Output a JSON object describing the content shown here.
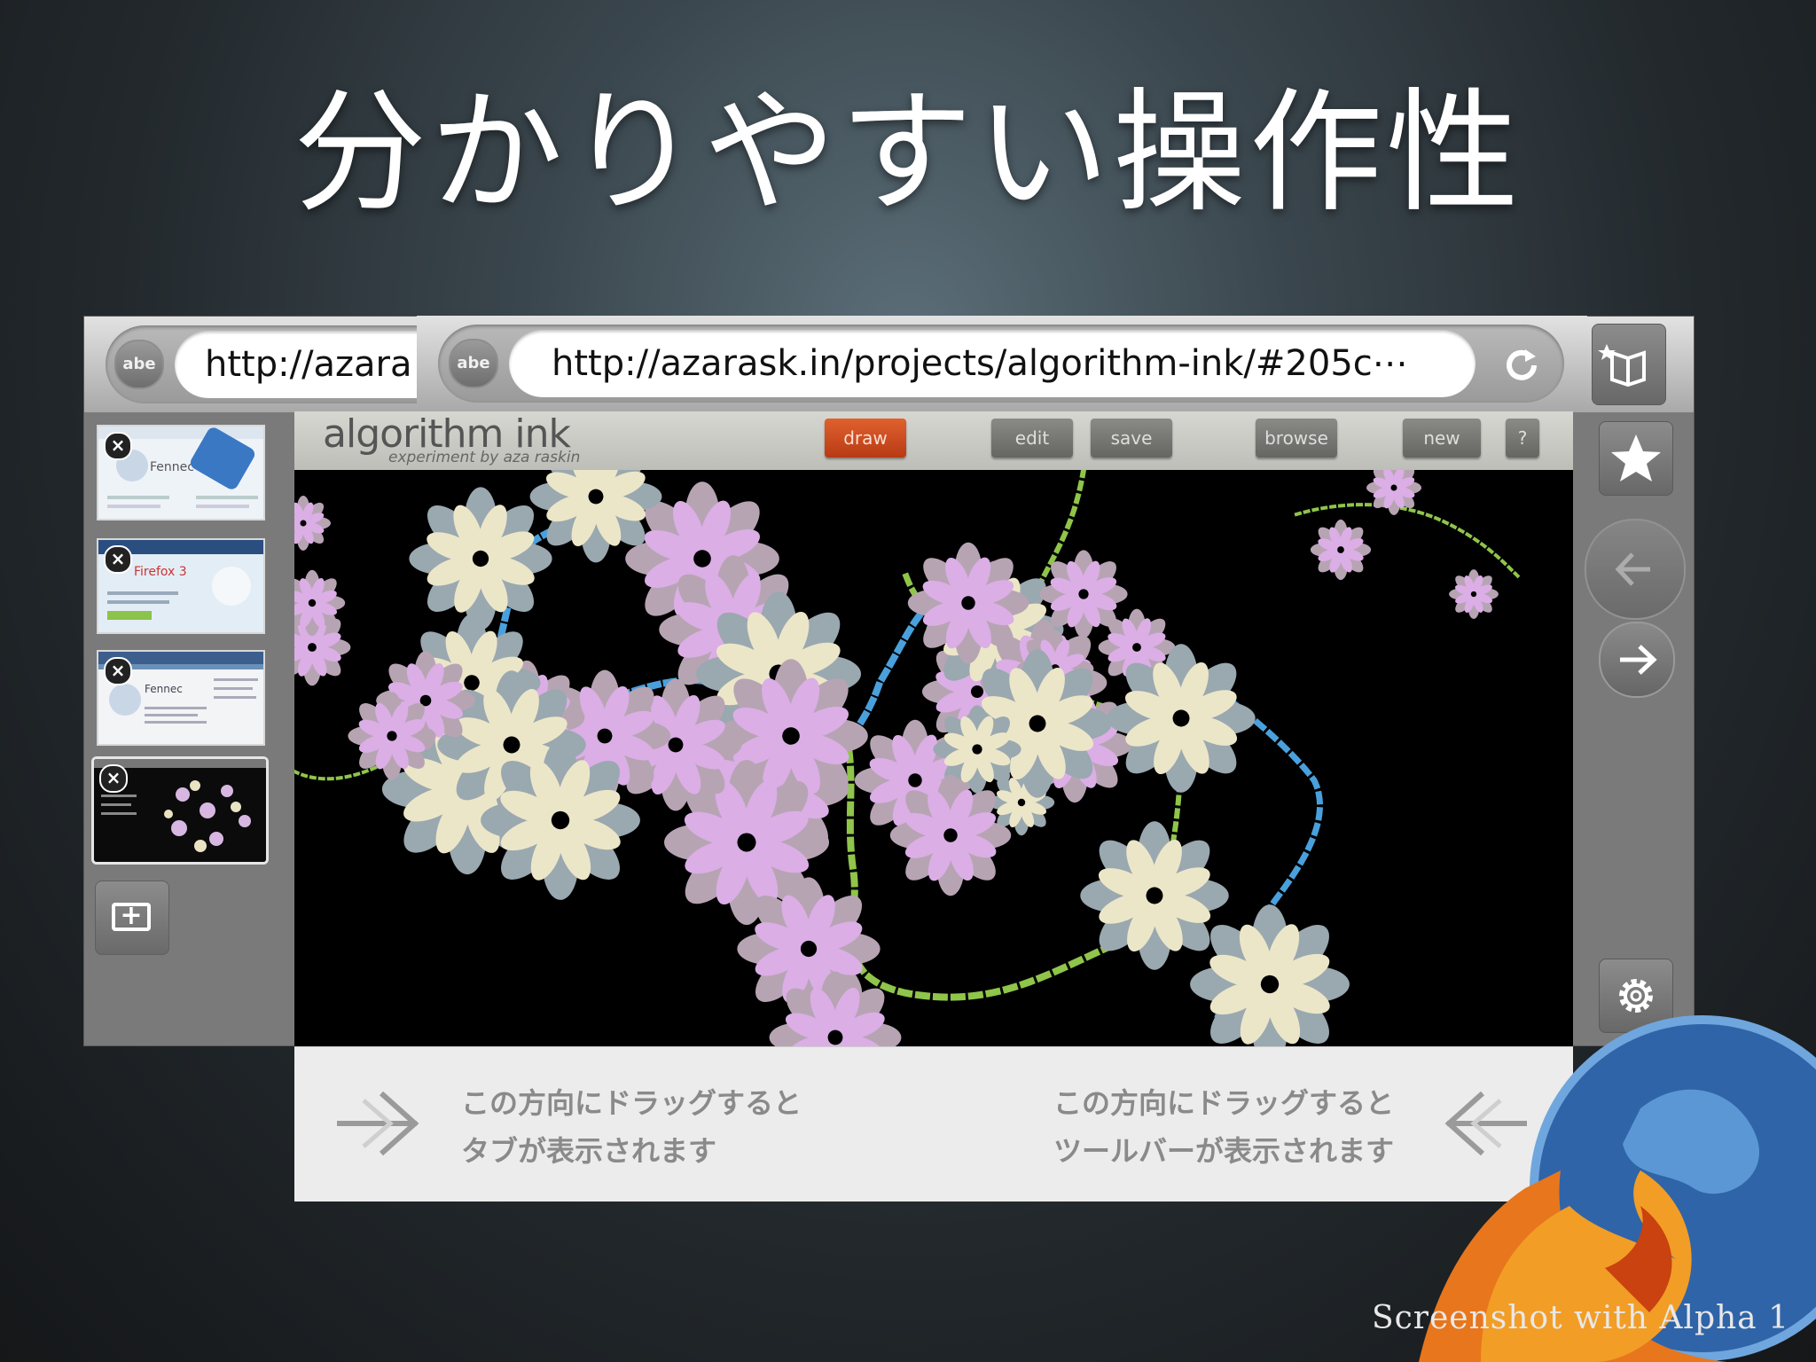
{
  "slide": {
    "title": "分かりやすい操作性",
    "caption": "Screenshot with Alpha 1"
  },
  "back_window": {
    "site_icon_label": "abe",
    "url": "http://azara",
    "tabs": [
      {
        "name": "Fennec",
        "selected": false
      },
      {
        "name": "Firefox 3",
        "selected": false
      },
      {
        "name": "Fennec",
        "selected": false
      },
      {
        "name": "algorithm ink",
        "selected": true
      }
    ],
    "close_glyph": "×",
    "new_tab_glyph": "+"
  },
  "front_window": {
    "site_icon_label": "abe",
    "url": "http://azarask.in/projects/algorithm-ink/#205c⋯",
    "reload_icon": "reload-icon"
  },
  "page": {
    "logo": "algorithm ink",
    "subtitle": "experiment by aza raskin",
    "buttons": {
      "draw": "draw",
      "edit": "edit",
      "save": "save",
      "browse": "browse",
      "new": "new",
      "help": "?"
    }
  },
  "sidebar_controls": {
    "bookmarks_icon": "bookmarks-icon",
    "star_icon": "star-icon",
    "back_icon": "back-arrow-icon",
    "forward_icon": "forward-arrow-icon",
    "settings_icon": "gear-icon"
  },
  "hints": {
    "left_line1": "この方向にドラッグすると",
    "left_line2": "タブが表示されます",
    "right_line1": "この方向にドラッグすると",
    "right_line2": "ツールバーが表示されます"
  },
  "colors": {
    "draw_button": "#d24a1e",
    "flower_pink": "#d9a9e6",
    "flower_cream": "#eee8cc",
    "dot_blue": "#4aa0dc",
    "dot_green": "#8fc54a"
  }
}
